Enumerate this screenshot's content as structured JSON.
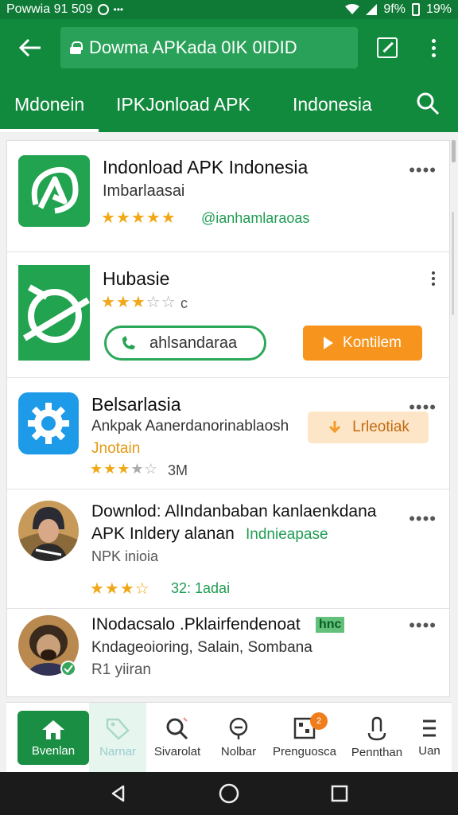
{
  "status_bar": {
    "carrier": "Powwia 91  509",
    "battery_pct": "9f%",
    "time": "19%"
  },
  "app_bar": {
    "url": "Dowma APKada 0IK 0IDID"
  },
  "tabs": [
    {
      "label": "Mdonein"
    },
    {
      "label": "IPKJonload APK"
    },
    {
      "label": "Indonesia"
    }
  ],
  "apps": [
    {
      "title": "Indonload APK Indonesia",
      "subtitle": "Imbarlaasai",
      "rating": 5,
      "tag": "@ianhamlaraoas",
      "icon": "green-arrow-icon"
    },
    {
      "title": "Hubasie",
      "rating": 3.5,
      "count": "c",
      "outline_button": "ahlsandaraa",
      "install_button": "Kontilem",
      "icon": "green-leaf-icon"
    },
    {
      "title": "Belsarlasia",
      "subtitle": "Ankpak Aanerdanorinablaosh",
      "tag": "Jnotain",
      "rating": 3,
      "count": "3M",
      "button": "Lrleotiak",
      "icon": "gear-icon"
    },
    {
      "title": "Downlod: AlIndanbaban kanlaenkdana",
      "line2_a": "APK Inldery alanan",
      "line2_b": "Indnieapase",
      "subtitle": "NPK inioia",
      "rating": 3.5,
      "count": "32: 1adai",
      "avatar": "person-avatar"
    },
    {
      "title": "INodacsalo .Pklairfendenoat",
      "badge": "hnc",
      "subtitle": "Kndageoioring, Salain, Sombana",
      "meta": "R1 yiiran",
      "avatar": "person-avatar"
    }
  ],
  "bottom_nav": [
    {
      "label": "Bvenlan",
      "icon": "home-icon"
    },
    {
      "label": "Narnar",
      "icon": "tag-icon"
    },
    {
      "label": "Sivarolat",
      "icon": "search-icon"
    },
    {
      "label": "Nolbar",
      "icon": "location-icon"
    },
    {
      "label": "Prenguosca",
      "icon": "qr-icon",
      "badge": "2"
    },
    {
      "label": "Pennthan",
      "icon": "touch-icon"
    },
    {
      "label": "Uan",
      "icon": "menu-icon"
    }
  ],
  "colors": {
    "primary": "#128a3e",
    "accent": "#f7941d",
    "star": "#f0a818"
  }
}
